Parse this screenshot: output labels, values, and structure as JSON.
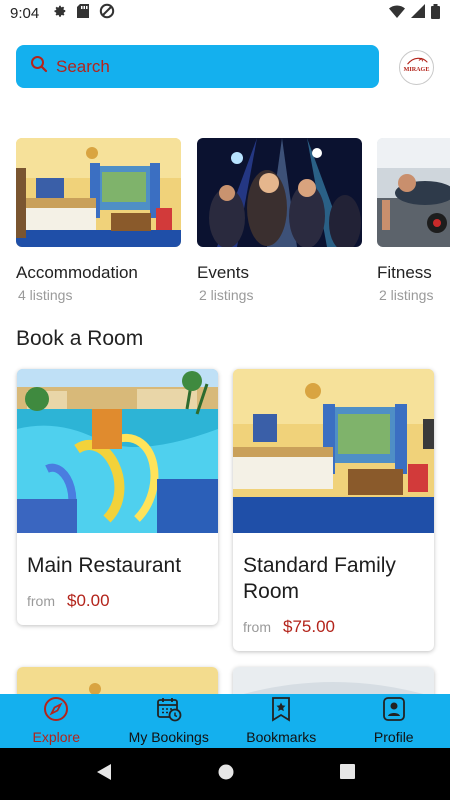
{
  "status_bar": {
    "time": "9:04",
    "left_icons": [
      "gear-icon",
      "sd-card-icon",
      "data-saver-icon"
    ],
    "right_icons": [
      "wifi-icon",
      "signal-icon",
      "battery-icon"
    ]
  },
  "search": {
    "placeholder": "Search",
    "icon": "search-icon"
  },
  "logo": {
    "text": "MIRAGE"
  },
  "categories": [
    {
      "title": "Accommodation",
      "subtitle": "4 listings",
      "image": "hotel-room-photo"
    },
    {
      "title": "Events",
      "subtitle": "2 listings",
      "image": "party-crowd-photo"
    },
    {
      "title": "Fitness",
      "subtitle": "2 listings",
      "image": "gym-workout-photo"
    }
  ],
  "section_title": "Book a Room",
  "rooms": [
    {
      "title": "Main Restaurant",
      "from_label": "from",
      "price": "$0.00",
      "image": "water-park-pool-photo"
    },
    {
      "title": "Standard Family Room",
      "from_label": "from",
      "price": "$75.00",
      "image": "hotel-room-photo"
    }
  ],
  "bottom_nav": [
    {
      "label": "Explore",
      "icon": "compass-icon",
      "active": true
    },
    {
      "label": "My Bookings",
      "icon": "calendar-clock-icon",
      "active": false
    },
    {
      "label": "Bookmarks",
      "icon": "bookmark-star-icon",
      "active": false
    },
    {
      "label": "Profile",
      "icon": "profile-badge-icon",
      "active": false
    }
  ],
  "system_nav": [
    "back-icon",
    "home-icon",
    "recents-icon"
  ],
  "colors": {
    "accent_blue": "#14b0ee",
    "accent_red": "#b3241b",
    "text_dark": "#222222",
    "text_muted": "#9a9a9a"
  }
}
